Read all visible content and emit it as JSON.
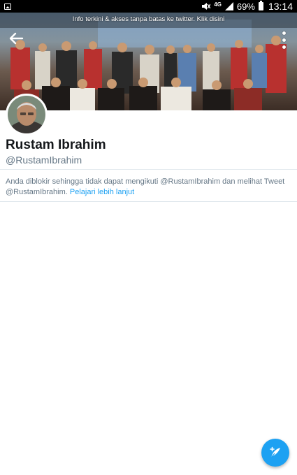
{
  "status_bar": {
    "network": "4G",
    "battery": "69%",
    "time": "13:14"
  },
  "banner": {
    "notice": "Info terkini & akses tanpa batas ke twitter. Klik disini"
  },
  "profile": {
    "display_name": "Rustam Ibrahim",
    "handle": "@RustamIbrahim"
  },
  "blocked": {
    "message": "Anda diblokir sehingga tidak dapat mengikuti @RustamIbrahim dan melihat Tweet @RustamIbrahim.",
    "link": "Pelajari lebih lanjut"
  },
  "colors": {
    "accent": "#1da1f2",
    "secondary_text": "#657786",
    "divider": "#e1e8ed"
  },
  "icons": {
    "back": "arrow-left-icon",
    "more": "more-vertical-icon",
    "compose": "compose-tweet-icon"
  }
}
